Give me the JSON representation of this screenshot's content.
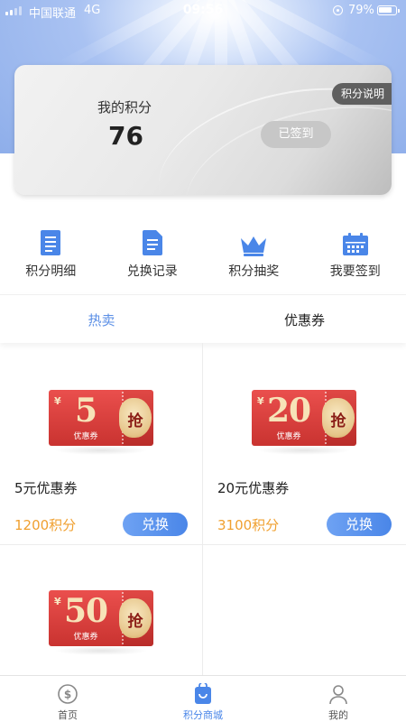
{
  "status_bar": {
    "carrier": "中国联通",
    "network": "4G",
    "time": "09:56",
    "battery": "79%"
  },
  "points_card": {
    "label": "我的积分",
    "value": "76",
    "rules_button": "积分说明",
    "checkin_button": "已签到"
  },
  "menu": [
    {
      "label": "积分明细",
      "icon": "list-document-icon"
    },
    {
      "label": "兑换记录",
      "icon": "record-document-icon"
    },
    {
      "label": "积分抽奖",
      "icon": "crown-icon"
    },
    {
      "label": "我要签到",
      "icon": "calendar-icon"
    }
  ],
  "tabs": [
    {
      "label": "热卖",
      "active": true
    },
    {
      "label": "优惠券",
      "active": false
    }
  ],
  "products": [
    {
      "coupon_amount": "5",
      "coupon_sub": "优惠券",
      "coupon_symbol": "¥",
      "coupon_seal": "抢",
      "name": "5元优惠券",
      "price": "1200积分",
      "button": "兑换"
    },
    {
      "coupon_amount": "20",
      "coupon_sub": "优惠券",
      "coupon_symbol": "¥",
      "coupon_seal": "抢",
      "name": "20元优惠券",
      "price": "3100积分",
      "button": "兑换"
    },
    {
      "coupon_amount": "50",
      "coupon_sub": "优惠券",
      "coupon_symbol": "¥",
      "coupon_seal": "抢"
    }
  ],
  "bottom_nav": [
    {
      "label": "首页",
      "icon": "home-coin-icon",
      "active": false
    },
    {
      "label": "积分商城",
      "icon": "shop-bag-icon",
      "active": true
    },
    {
      "label": "我的",
      "icon": "profile-icon",
      "active": false
    }
  ],
  "colors": {
    "accent": "#4a86e8",
    "price": "#f0a030",
    "coupon_red": "#d93d3a"
  }
}
